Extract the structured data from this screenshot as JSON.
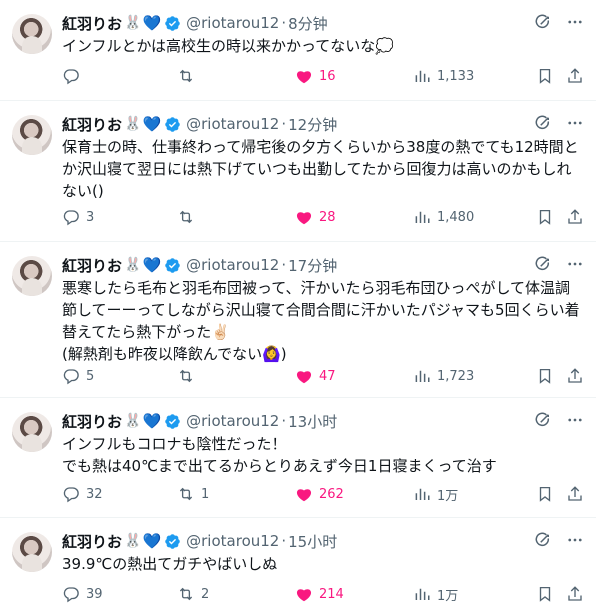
{
  "author": {
    "name": "紅羽りお",
    "emoji_rabbit": "🐰",
    "emoji_heart": "💙",
    "handle": "@riotarou12"
  },
  "colors": {
    "like": "#f91880",
    "verified": "#1d9bf0",
    "muted": "#536471"
  },
  "tweets": [
    {
      "time": "8分钟",
      "text": "インフルとかは高校生の時以来かかってないな💭",
      "replies": "",
      "retweets": "",
      "likes": "16",
      "views": "1,133"
    },
    {
      "time": "12分钟",
      "text": "保育士の時、仕事終わって帰宅後の夕方くらいから38度の熱でても12時間とか沢山寝て翌日には熱下げていつも出勤してたから回復力は高いのかもしれない()",
      "replies": "3",
      "retweets": "",
      "likes": "28",
      "views": "1,480"
    },
    {
      "time": "17分钟",
      "text": "悪寒したら毛布と羽毛布団被って、汗かいたら羽毛布団ひっぺがして体温調節してーーってしながら沢山寝て合間合間に汗かいたパジャマも5回くらい着替えてたら熱下がった✌🏻\n(解熱剤も昨夜以降飲んでない🙆‍♀️)",
      "replies": "5",
      "retweets": "",
      "likes": "47",
      "views": "1,723"
    },
    {
      "time": "13小时",
      "text": "インフルもコロナも陰性だった！\nでも熱は40℃まで出てるからとりあえず今日1日寝まくって治す",
      "replies": "32",
      "retweets": "1",
      "likes": "262",
      "views": "1万"
    },
    {
      "time": "15小时",
      "text": "39.9℃の熱出てガチやばいしぬ",
      "replies": "39",
      "retweets": "2",
      "likes": "214",
      "views": "1万"
    }
  ]
}
